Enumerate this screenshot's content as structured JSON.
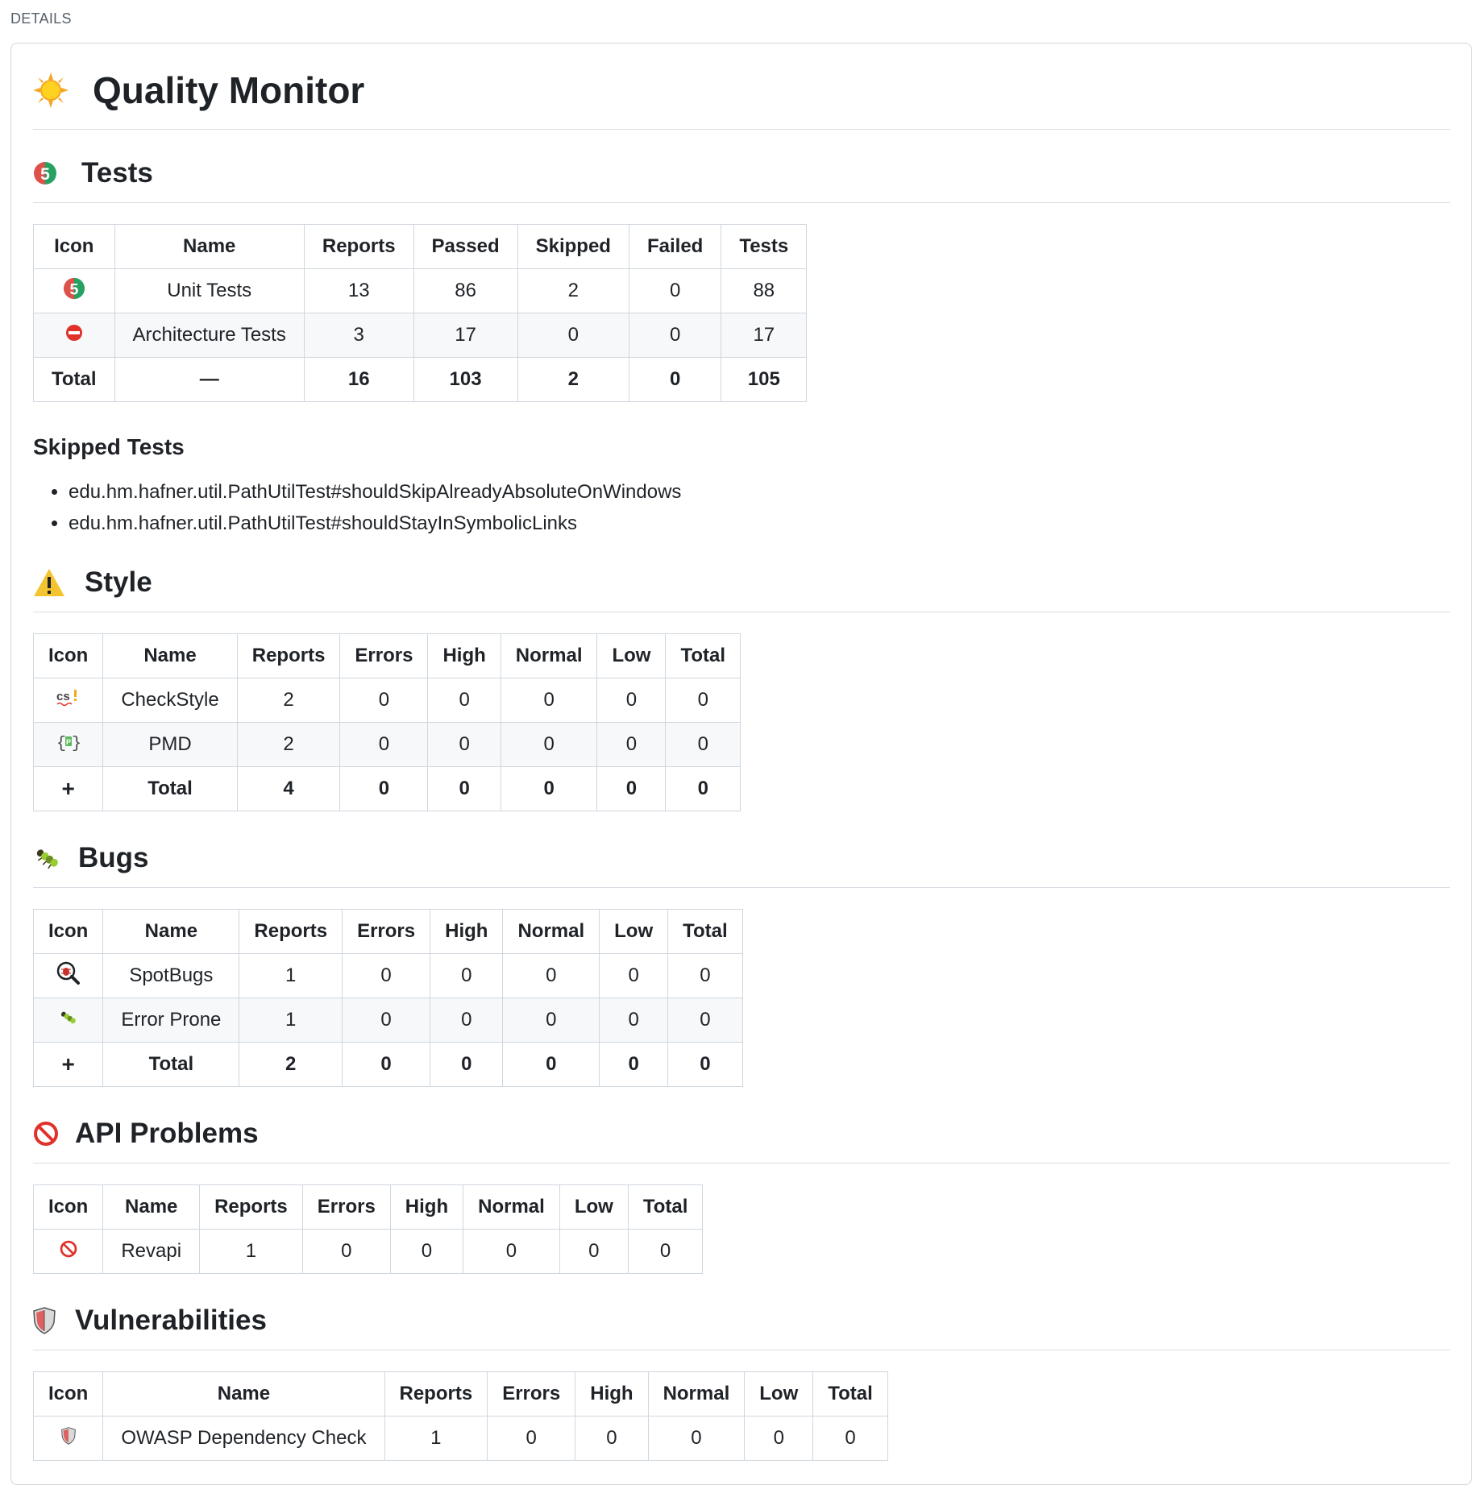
{
  "details_label": "DETAILS",
  "title": "Quality Monitor",
  "tests": {
    "heading": "Tests",
    "columns": [
      "Icon",
      "Name",
      "Reports",
      "Passed",
      "Skipped",
      "Failed",
      "Tests"
    ],
    "rows": [
      {
        "icon": "junit5-icon",
        "name": "Unit Tests",
        "reports": "13",
        "passed": "86",
        "skipped": "2",
        "failed": "0",
        "tests": "88"
      },
      {
        "icon": "no-entry-icon",
        "name": "Architecture Tests",
        "reports": "3",
        "passed": "17",
        "skipped": "0",
        "failed": "0",
        "tests": "17"
      }
    ],
    "total": {
      "label": "Total",
      "name": "—",
      "reports": "16",
      "passed": "103",
      "skipped": "2",
      "failed": "0",
      "tests": "105"
    },
    "skipped_heading": "Skipped Tests",
    "skipped_items": [
      "edu.hm.hafner.util.PathUtilTest#shouldSkipAlreadyAbsoluteOnWindows",
      "edu.hm.hafner.util.PathUtilTest#shouldStayInSymbolicLinks"
    ]
  },
  "style": {
    "heading": "Style",
    "columns": [
      "Icon",
      "Name",
      "Reports",
      "Errors",
      "High",
      "Normal",
      "Low",
      "Total"
    ],
    "rows": [
      {
        "icon": "checkstyle-icon",
        "name": "CheckStyle",
        "reports": "2",
        "errors": "0",
        "high": "0",
        "normal": "0",
        "low": "0",
        "total": "0"
      },
      {
        "icon": "pmd-icon",
        "name": "PMD",
        "reports": "2",
        "errors": "0",
        "high": "0",
        "normal": "0",
        "low": "0",
        "total": "0"
      }
    ],
    "total": {
      "icon": "+",
      "name": "Total",
      "reports": "4",
      "errors": "0",
      "high": "0",
      "normal": "0",
      "low": "0",
      "total": "0"
    }
  },
  "bugs": {
    "heading": "Bugs",
    "columns": [
      "Icon",
      "Name",
      "Reports",
      "Errors",
      "High",
      "Normal",
      "Low",
      "Total"
    ],
    "rows": [
      {
        "icon": "spotbugs-icon",
        "name": "SpotBugs",
        "reports": "1",
        "errors": "0",
        "high": "0",
        "normal": "0",
        "low": "0",
        "total": "0"
      },
      {
        "icon": "bug-icon",
        "name": "Error Prone",
        "reports": "1",
        "errors": "0",
        "high": "0",
        "normal": "0",
        "low": "0",
        "total": "0"
      }
    ],
    "total": {
      "icon": "+",
      "name": "Total",
      "reports": "2",
      "errors": "0",
      "high": "0",
      "normal": "0",
      "low": "0",
      "total": "0"
    }
  },
  "api": {
    "heading": "API Problems",
    "columns": [
      "Icon",
      "Name",
      "Reports",
      "Errors",
      "High",
      "Normal",
      "Low",
      "Total"
    ],
    "rows": [
      {
        "icon": "prohibited-icon",
        "name": "Revapi",
        "reports": "1",
        "errors": "0",
        "high": "0",
        "normal": "0",
        "low": "0",
        "total": "0"
      }
    ]
  },
  "vuln": {
    "heading": "Vulnerabilities",
    "columns": [
      "Icon",
      "Name",
      "Reports",
      "Errors",
      "High",
      "Normal",
      "Low",
      "Total"
    ],
    "rows": [
      {
        "icon": "shield-icon",
        "name": "OWASP Dependency Check",
        "reports": "1",
        "errors": "0",
        "high": "0",
        "normal": "0",
        "low": "0",
        "total": "0"
      }
    ]
  },
  "colors": {
    "border": "#d0d7de",
    "alt_row": "#f6f8fa",
    "text": "#1f2328",
    "warning_yellow": "#f4c430",
    "prohibited_red": "#e0322b",
    "junit_green": "#25a162"
  }
}
